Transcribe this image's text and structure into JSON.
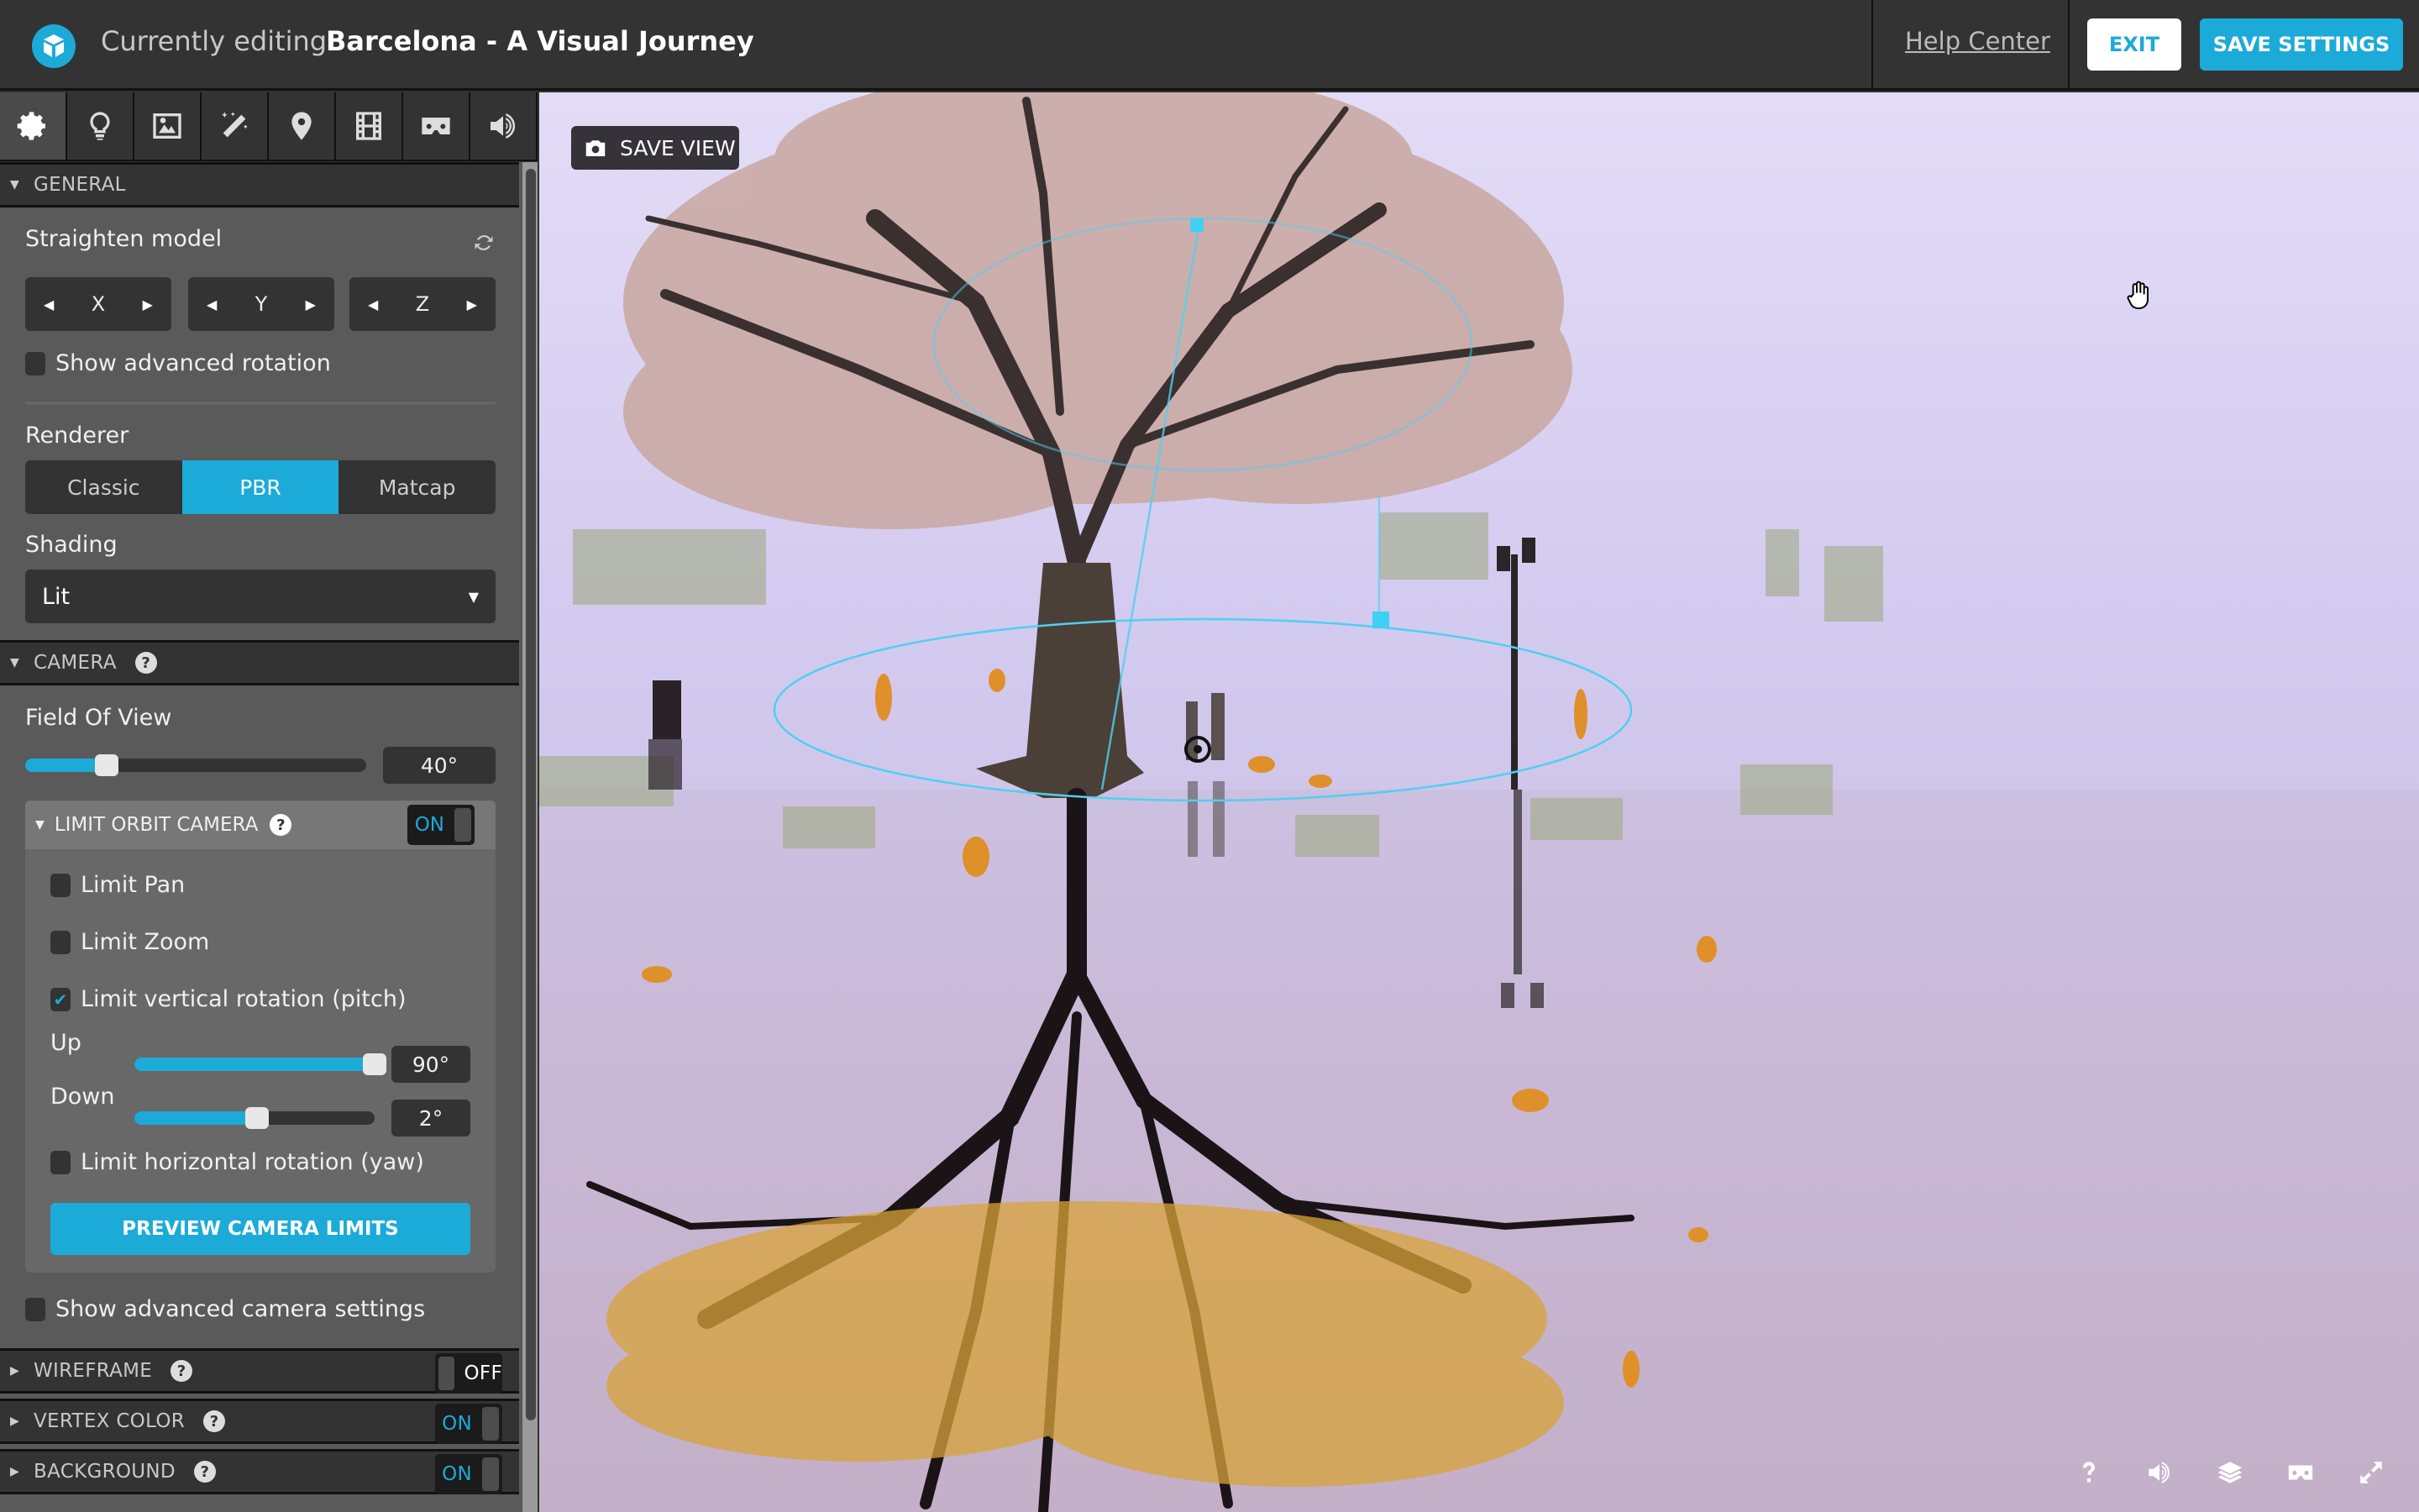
{
  "header": {
    "logo": "sketchfab-logo-icon",
    "title_prefix": "Currently editing",
    "title_name": "Barcelona - A Visual Journey",
    "help_link": "Help Center",
    "exit_label": "EXIT",
    "save_label": "SAVE SETTINGS"
  },
  "colors": {
    "accent": "#1caad9",
    "header_bg": "#333333",
    "panel_bg": "#5a5a5a",
    "control_bg": "#333333"
  },
  "toolbar": {
    "tabs": [
      {
        "icon": "gear-icon",
        "name": "scene-settings",
        "active": true
      },
      {
        "icon": "lightbulb-icon",
        "name": "lighting",
        "active": false
      },
      {
        "icon": "image-icon",
        "name": "materials",
        "active": false
      },
      {
        "icon": "magic-wand-icon",
        "name": "post-processing",
        "active": false
      },
      {
        "icon": "map-pin-icon",
        "name": "annotations",
        "active": false
      },
      {
        "icon": "film-icon",
        "name": "animation",
        "active": false
      },
      {
        "icon": "vr-headset-icon",
        "name": "vr",
        "active": false
      },
      {
        "icon": "speaker-icon",
        "name": "sound",
        "active": false
      }
    ]
  },
  "general": {
    "title": "GENERAL",
    "straighten_label": "Straighten model",
    "axes": [
      "X",
      "Y",
      "Z"
    ],
    "show_adv_rotation": {
      "label": "Show advanced rotation",
      "checked": false
    },
    "renderer_label": "Renderer",
    "renderer_options": [
      "Classic",
      "PBR",
      "Matcap"
    ],
    "renderer_selected": "PBR",
    "shading_label": "Shading",
    "shading_value": "Lit"
  },
  "camera": {
    "title": "CAMERA",
    "fov_label": "Field Of View",
    "fov_value": "40°",
    "fov_fraction": 0.24,
    "limit_orbit": {
      "title": "LIMIT ORBIT CAMERA",
      "toggle": "ON",
      "limit_pan": {
        "label": "Limit Pan",
        "checked": false
      },
      "limit_zoom": {
        "label": "Limit Zoom",
        "checked": false
      },
      "limit_pitch": {
        "label": "Limit vertical rotation (pitch)",
        "checked": true
      },
      "up_label": "Up",
      "up_value": "90°",
      "up_fraction": 1.0,
      "down_label": "Down",
      "down_value": "2°",
      "down_fraction": 0.51,
      "limit_yaw": {
        "label": "Limit horizontal rotation (yaw)",
        "checked": false
      },
      "preview_label": "PREVIEW CAMERA LIMITS"
    },
    "show_adv_camera": {
      "label": "Show advanced camera settings",
      "checked": false
    }
  },
  "sections": [
    {
      "title": "WIREFRAME",
      "toggle": "OFF"
    },
    {
      "title": "VERTEX COLOR",
      "toggle": "ON"
    },
    {
      "title": "BACKGROUND",
      "toggle": "ON"
    }
  ],
  "viewport": {
    "save_view_label": "SAVE VIEW",
    "controls": [
      "help-icon",
      "sound-icon",
      "layers-icon",
      "vr-icon",
      "fullscreen-icon"
    ]
  }
}
